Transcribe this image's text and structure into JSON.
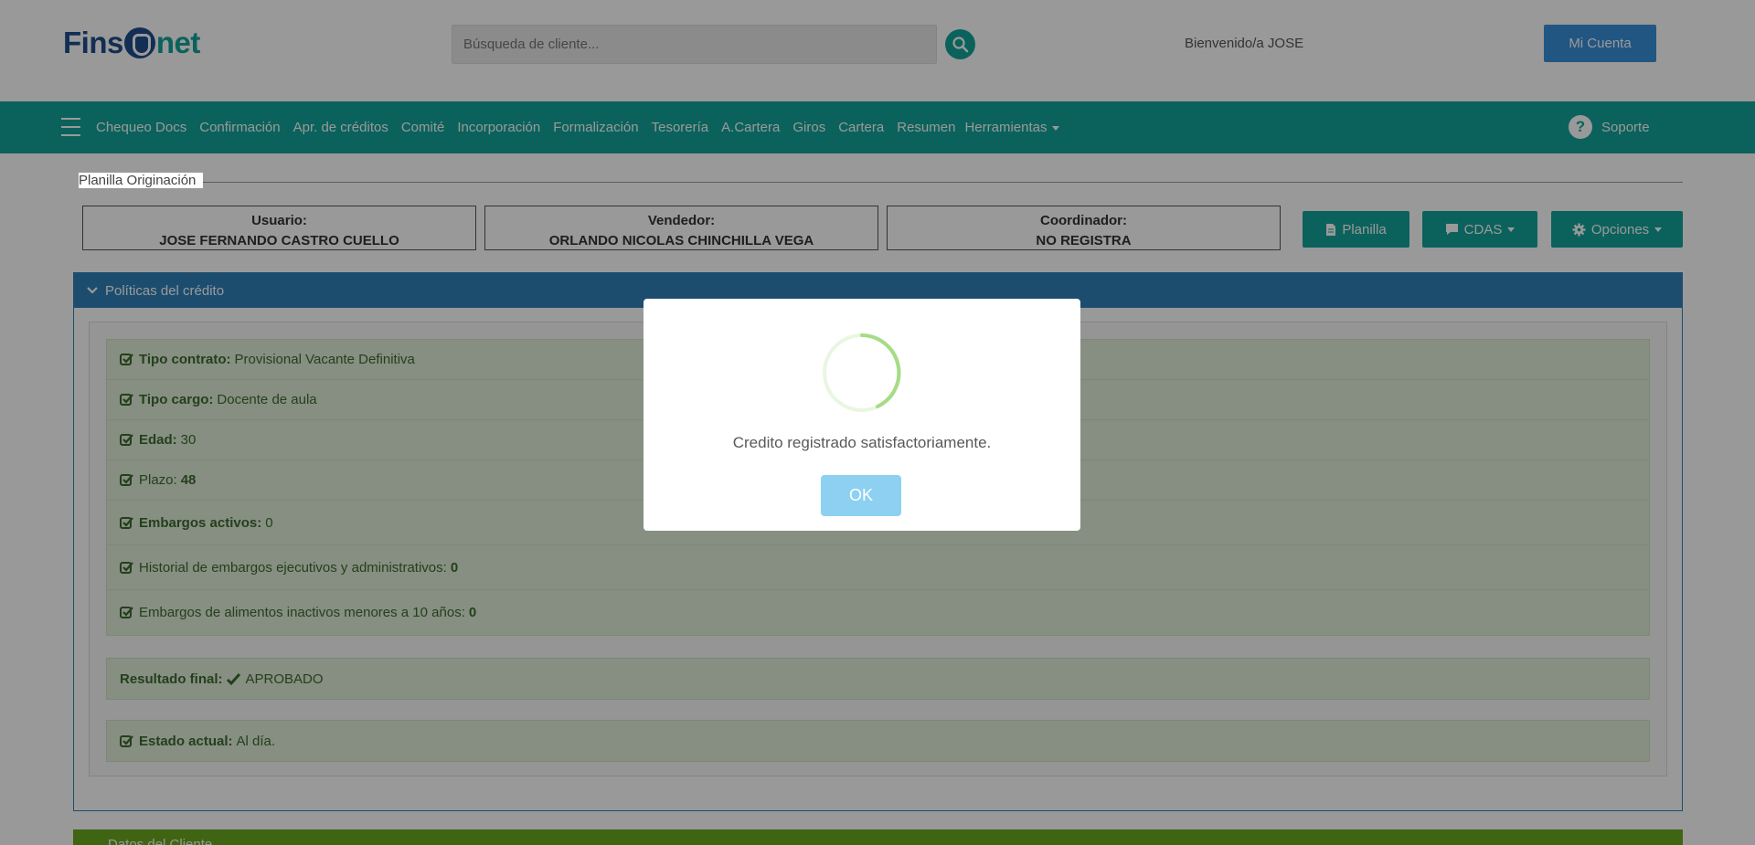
{
  "header": {
    "logo_prefix": "Fins",
    "logo_suffix": "net",
    "search_placeholder": "Búsqueda de cliente...",
    "welcome": "Bienvenido/a JOSE",
    "account_label": "Mi Cuenta"
  },
  "nav": {
    "items": [
      "Chequeo Docs",
      "Confirmación",
      "Apr. de créditos",
      "Comité",
      "Incorporación",
      "Formalización",
      "Tesorería",
      "A.Cartera",
      "Giros",
      "Cartera",
      "Resumen"
    ],
    "tools_label": "Herramientas",
    "support_label": "Soporte"
  },
  "section": {
    "title": "Planilla Originación"
  },
  "people": {
    "user_label": "Usuario:",
    "user_value": "JOSE FERNANDO CASTRO CUELLO",
    "seller_label": "Vendedor:",
    "seller_value": "ORLANDO NICOLAS CHINCHILLA VEGA",
    "coord_label": "Coordinador:",
    "coord_value": "NO REGISTRA"
  },
  "actions": {
    "planilla": "Planilla",
    "cdas": "CDAS",
    "opciones": "Opciones"
  },
  "panel": {
    "title": "Políticas del crédito",
    "rows": [
      {
        "label": "Tipo contrato:",
        "value": "Provisional Vacante Definitiva"
      },
      {
        "label": "Tipo cargo:",
        "value": "Docente de aula"
      },
      {
        "label": "Edad:",
        "value": "30"
      },
      {
        "label": "Plazo:",
        "value": "48"
      },
      {
        "label": "Embargos activos:",
        "value": "0"
      },
      {
        "label": "Historial de embargos ejecutivos y administrativos:",
        "value": "0"
      },
      {
        "label": "Embargos de alimentos inactivos menores a 10 años:",
        "value": "0"
      }
    ],
    "result_label": "Resultado final:",
    "result_value": "APROBADO",
    "status_label": "Estado actual:",
    "status_value": "Al día."
  },
  "next_panel": {
    "title": "Datos del Cliente"
  },
  "modal": {
    "message": "Credito registrado satisfactoriamente.",
    "ok_label": "OK"
  },
  "colors": {
    "teal": "#13a49a",
    "blue": "#2f80b9",
    "green_panel": "#dfefd7",
    "ok_button": "#8dd0f2"
  }
}
